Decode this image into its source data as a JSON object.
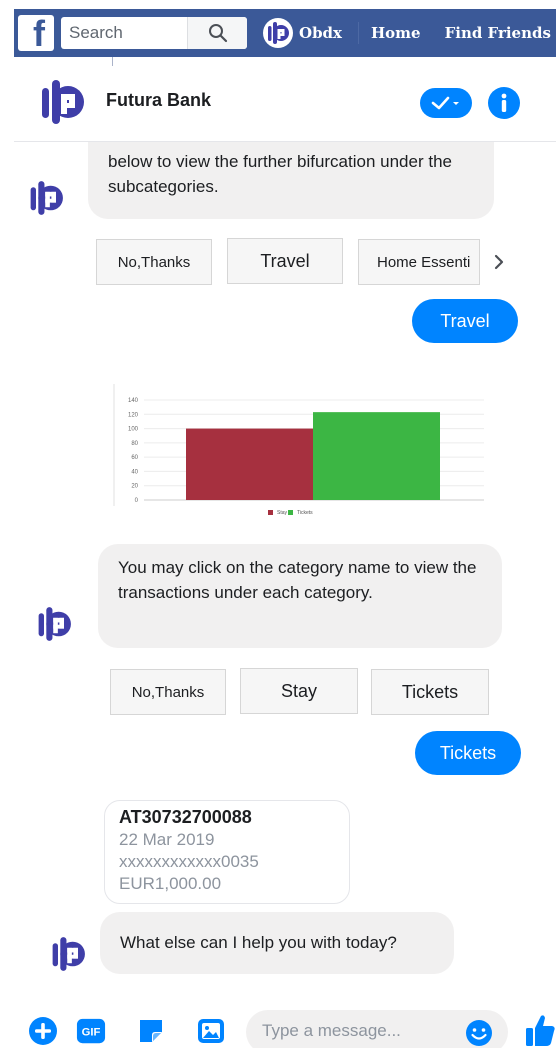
{
  "topbar": {
    "logo_letter": "f",
    "search_placeholder": "Search",
    "profile_name": "Obdx",
    "nav": [
      "Home",
      "Find Friends"
    ]
  },
  "chat_header": {
    "title": "Futura Bank"
  },
  "messages": {
    "intro_text": "below to view the further bifurcation under the subcategories.",
    "quick_replies_1": [
      "No,Thanks",
      "Travel",
      "Home Essenti"
    ],
    "user_reply_1": "Travel",
    "category_prompt": "You may click on the category name to view the transactions under each category.",
    "quick_replies_2": [
      "No,Thanks",
      "Stay",
      "Tickets"
    ],
    "user_reply_2": "Tickets",
    "transaction": {
      "reference": "AT30732700088",
      "date": "22 Mar 2019",
      "account": "xxxxxxxxxxxx0035",
      "amount": "EUR1,000.00"
    },
    "final_prompt": "What else can I help you with today?"
  },
  "composer": {
    "placeholder": "Type a message..."
  },
  "chart_data": {
    "type": "bar",
    "categories": [
      "Stay",
      "Tickets"
    ],
    "values": [
      100,
      123
    ],
    "colors": [
      "#a6303f",
      "#3cb644"
    ],
    "ylim": [
      0,
      140
    ],
    "yticks": [
      0,
      20,
      40,
      60,
      80,
      100,
      120,
      140
    ],
    "legend_placement": "bottom-center",
    "grid": true
  },
  "colors": {
    "facebook_blue": "#3b5998",
    "messenger_blue": "#0084ff",
    "bubble_grey": "#f1f0f0",
    "brand_indigo": "#3f3ea8"
  }
}
